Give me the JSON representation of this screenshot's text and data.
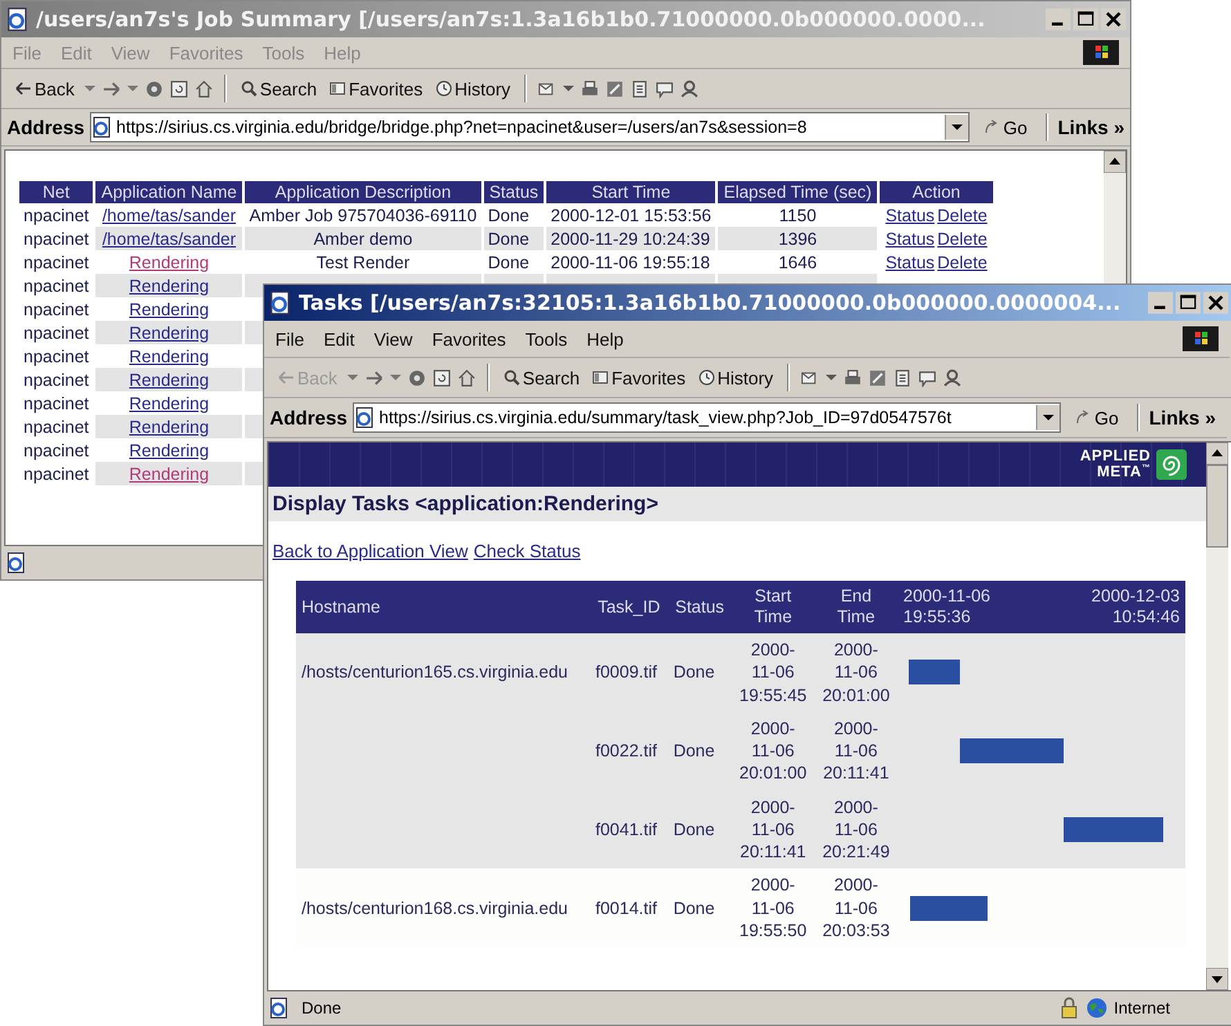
{
  "windows": [
    {
      "kind": "job_summary",
      "active": false,
      "title": "/users/an7s's Job Summary [/users/an7s:1.3a16b1b0.71000000.0b000000.0000...",
      "menu": [
        "File",
        "Edit",
        "View",
        "Favorites",
        "Tools",
        "Help"
      ],
      "toolbar": {
        "back": {
          "label": "Back",
          "disabled": false
        },
        "search": "Search",
        "favorites": "Favorites",
        "history": "History"
      },
      "address": {
        "label": "Address",
        "value": "https://sirius.cs.virginia.edu/bridge/bridge.php?net=npacinet&user=/users/an7s&session=8",
        "go": "Go",
        "links": "Links »"
      },
      "table": {
        "columns": [
          "Net",
          "Application Name",
          "Application Description",
          "Status",
          "Start Time",
          "Elapsed Time (sec)",
          "Action"
        ],
        "rows": [
          {
            "net": "npacinet",
            "app": {
              "text": "/home/tas/sander",
              "visited": false
            },
            "description": "Amber Job 975704036-69110",
            "status": "Done",
            "start": "2000-12-01 15:53:56",
            "elapsed": "1150",
            "actions": [
              "Status",
              "Delete"
            ]
          },
          {
            "net": "npacinet",
            "app": {
              "text": "/home/tas/sander",
              "visited": false
            },
            "description": "Amber demo",
            "status": "Done",
            "start": "2000-11-29 10:24:39",
            "elapsed": "1396",
            "actions": [
              "Status",
              "Delete"
            ]
          },
          {
            "net": "npacinet",
            "app": {
              "text": "Rendering",
              "visited": true
            },
            "description": "Test Render",
            "status": "Done",
            "start": "2000-11-06 19:55:18",
            "elapsed": "1646",
            "actions": [
              "Status",
              "Delete"
            ]
          },
          {
            "net": "npacinet",
            "app": {
              "text": "Rendering",
              "visited": false
            }
          },
          {
            "net": "npacinet",
            "app": {
              "text": "Rendering",
              "visited": false
            }
          },
          {
            "net": "npacinet",
            "app": {
              "text": "Rendering",
              "visited": false
            }
          },
          {
            "net": "npacinet",
            "app": {
              "text": "Rendering",
              "visited": false
            }
          },
          {
            "net": "npacinet",
            "app": {
              "text": "Rendering",
              "visited": false
            }
          },
          {
            "net": "npacinet",
            "app": {
              "text": "Rendering",
              "visited": false
            }
          },
          {
            "net": "npacinet",
            "app": {
              "text": "Rendering",
              "visited": false
            }
          },
          {
            "net": "npacinet",
            "app": {
              "text": "Rendering",
              "visited": false
            }
          },
          {
            "net": "npacinet",
            "app": {
              "text": "Rendering",
              "visited": true
            }
          }
        ]
      }
    },
    {
      "kind": "tasks",
      "active": true,
      "title": "Tasks [/users/an7s:32105:1.3a16b1b0.71000000.0b000000.0000004...",
      "menu": [
        "File",
        "Edit",
        "View",
        "Favorites",
        "Tools",
        "Help"
      ],
      "toolbar": {
        "back": {
          "label": "Back",
          "disabled": true
        },
        "search": "Search",
        "favorites": "Favorites",
        "history": "History"
      },
      "address": {
        "label": "Address",
        "value": "https://sirius.cs.virginia.edu/summary/task_view.php?Job_ID=97d0547576t",
        "go": "Go",
        "links": "Links »"
      },
      "banner": {
        "logo_top": "APPLIED",
        "logo_bottom": "META",
        "logo_mark": "™"
      },
      "heading": "Display Tasks <application:Rendering>",
      "links": [
        "Back to Application View",
        "Check Status"
      ],
      "task_table": {
        "columns": [
          "Hostname",
          "Task_ID",
          "Status",
          "Start\nTime",
          "End\nTime"
        ],
        "timeline_start": "2000-11-06\n19:55:36",
        "timeline_end": "2000-12-03\n10:54:46",
        "hosts": [
          {
            "hostname": "/hosts/centurion165.cs.virginia.edu",
            "tasks": [
              {
                "task_id": "f0009.tif",
                "status": "Done",
                "start_time": "2000-\n11-06\n19:55:45",
                "end_time": "2000-\n11-06\n20:01:00"
              },
              {
                "task_id": "f0022.tif",
                "status": "Done",
                "start_time": "2000-\n11-06\n20:01:00",
                "end_time": "2000-\n11-06\n20:11:41"
              },
              {
                "task_id": "f0041.tif",
                "status": "Done",
                "start_time": "2000-\n11-06\n20:11:41",
                "end_time": "2000-\n11-06\n20:21:49"
              }
            ]
          },
          {
            "hostname": "/hosts/centurion168.cs.virginia.edu",
            "tasks": [
              {
                "task_id": "f0014.tif",
                "status": "Done",
                "start_time": "2000-\n11-06\n19:55:50",
                "end_time": "2000-\n11-06\n20:03:53"
              }
            ]
          }
        ]
      },
      "status_bar": {
        "text": "Done",
        "zone": "Internet"
      }
    }
  ]
}
